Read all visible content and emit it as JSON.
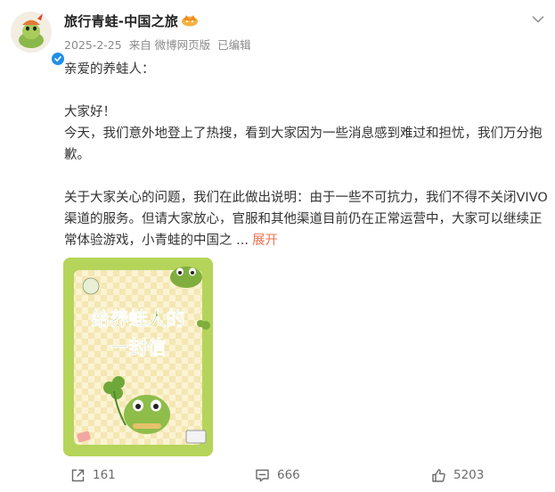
{
  "header": {
    "name": "旅行青蛙-中国之旅",
    "date": "2025-2-25",
    "source": "来自 微博网页版",
    "edited": "已编辑"
  },
  "post": {
    "salutation": "亲爱的养蛙人：",
    "greeting": "大家好！",
    "para1": "今天，我们意外地登上了热搜，看到大家因为一些消息感到难过和担忧，我们万分抱歉。",
    "para2": "关于大家关心的问题，我们在此做出说明：由于一些不可抗力，我们不得不关闭VIVO渠道的服务。但请大家放心，官服和其他渠道目前仍在正常运营中，大家可以继续正常体验游戏，小青蛙的中国之 ...",
    "expand": "展开"
  },
  "image": {
    "line1": "给养蛙人的",
    "line2": "一封信"
  },
  "actions": {
    "repost_count": "161",
    "comment_count": "666",
    "like_count": "5203"
  },
  "colors": {
    "accent": "#eb7350",
    "verified": "#1f8fe8",
    "card_green": "#b5d45a",
    "title_green": "#4f9a2e"
  },
  "icons": [
    "chevron-down-icon",
    "verified-icon",
    "crown-badge-icon",
    "repost-icon",
    "comment-icon",
    "like-icon"
  ]
}
